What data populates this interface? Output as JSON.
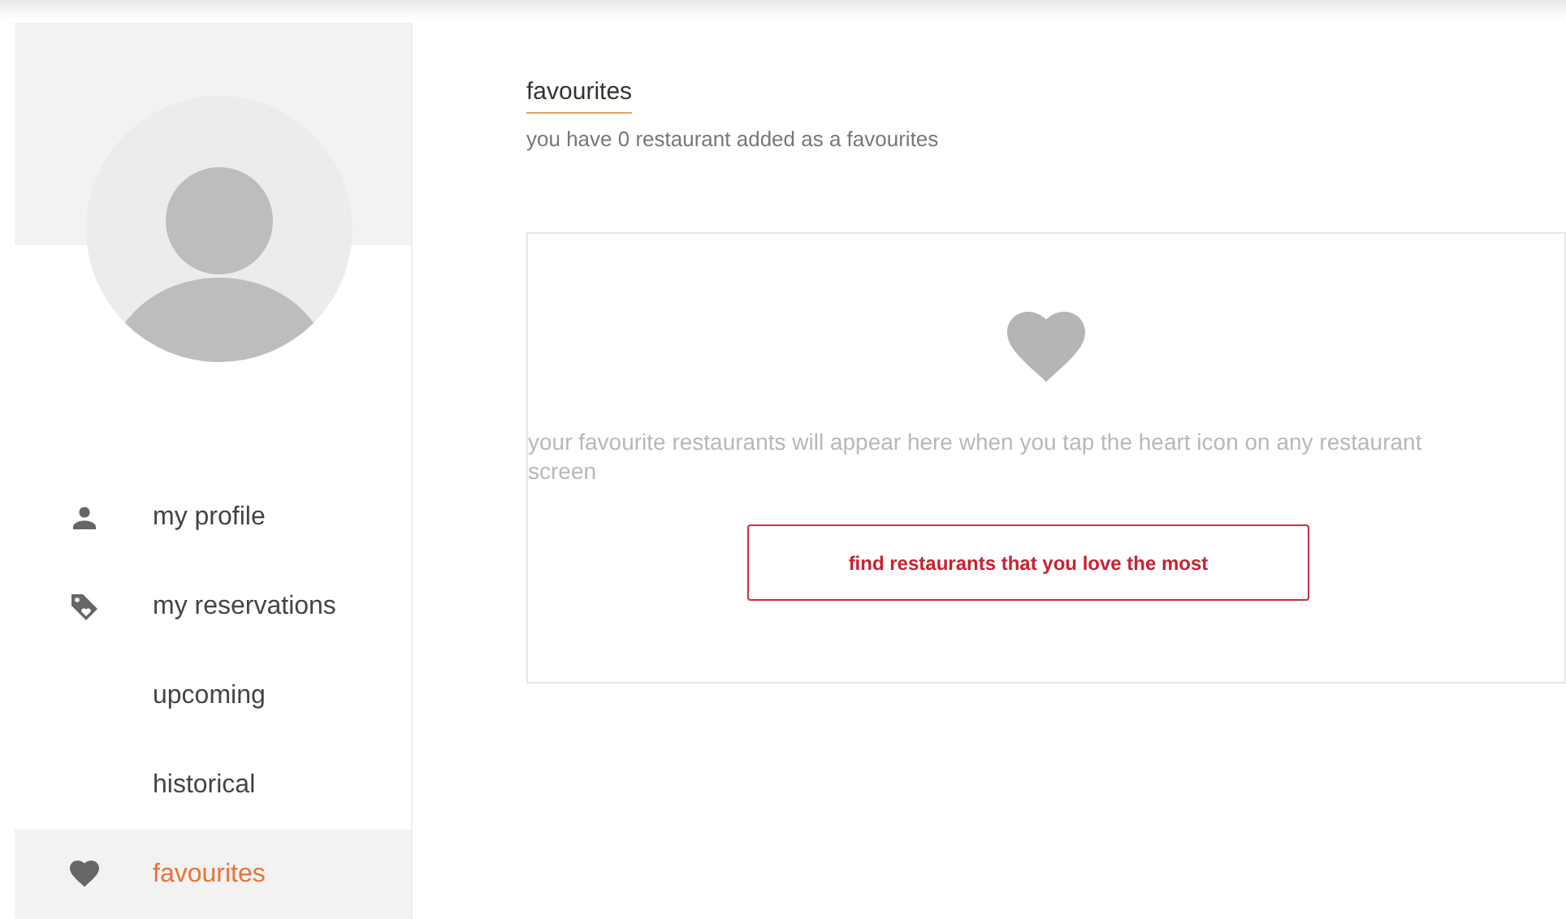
{
  "sidebar": {
    "items": [
      {
        "label": "my profile",
        "kind": "person",
        "selected": false
      },
      {
        "label": "my reservations",
        "kind": "tag",
        "selected": false
      },
      {
        "label": "upcoming",
        "kind": "sub",
        "selected": false
      },
      {
        "label": "historical",
        "kind": "sub",
        "selected": false
      },
      {
        "label": "favourites",
        "kind": "heart",
        "selected": true
      }
    ]
  },
  "main": {
    "title": "favourites",
    "subtitle": "you have 0 restaurant added as a favourites",
    "empty_state": {
      "message": "your favourite restaurants will appear here when you tap the heart icon on any restaurant screen",
      "button": "find restaurants that you love the most"
    }
  }
}
